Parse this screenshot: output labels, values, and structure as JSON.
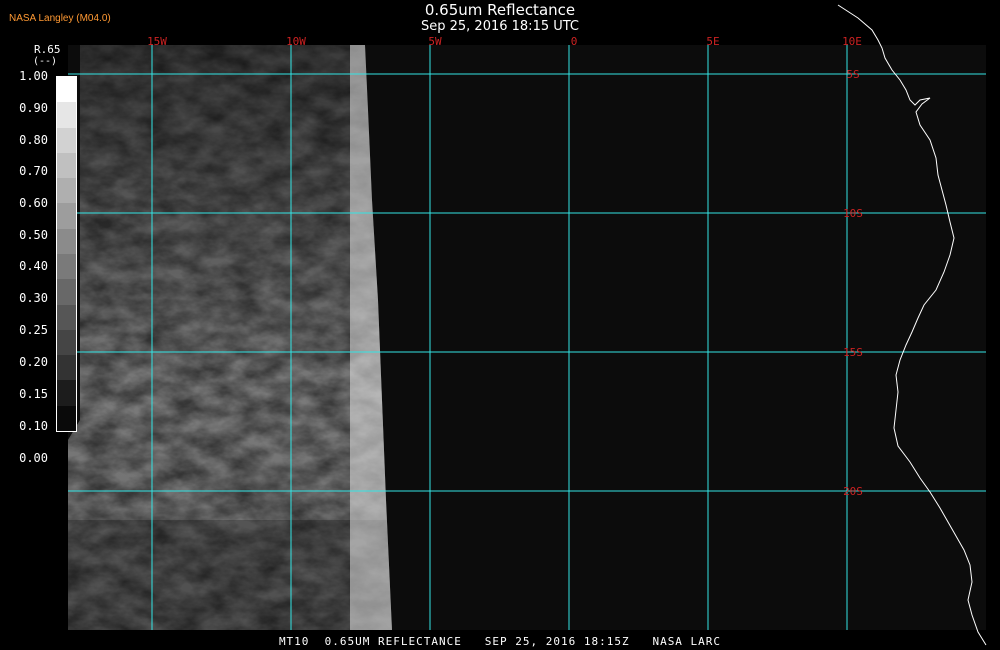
{
  "header": {
    "agency": "NASA Langley (M04.0)",
    "title": "0.65um Reflectance",
    "subtitle": "Sep 25, 2016 18:15 UTC"
  },
  "footer": {
    "caption": "MT10  0.65UM REFLECTANCE   SEP 25, 2016 18:15Z   NASA LARC"
  },
  "legend": {
    "title": "R.65",
    "unit": "(--)",
    "ticks": [
      "1.00",
      "0.90",
      "0.80",
      "0.70",
      "0.60",
      "0.50",
      "0.40",
      "0.30",
      "0.25",
      "0.20",
      "0.15",
      "0.10",
      "0.00"
    ],
    "swatch_colors": [
      "#ffffff",
      "#e6e6e6",
      "#d2d2d2",
      "#c0c0c0",
      "#afafaf",
      "#9d9d9d",
      "#8b8b8b",
      "#7a7a7a",
      "#686868",
      "#565656",
      "#454545",
      "#333333",
      "#1c1c1c",
      "#0a0a0a"
    ]
  },
  "map": {
    "grid_color": "#33e5e5",
    "lat_label_color": "#cc2222",
    "lon_label_color": "#cc2222",
    "coast_color": "#ffffff",
    "longitude_labels": [
      "15W",
      "10W",
      "5W",
      "0",
      "5E",
      "10E"
    ],
    "latitude_labels": [
      "5S",
      "10S",
      "15S",
      "20S"
    ]
  }
}
